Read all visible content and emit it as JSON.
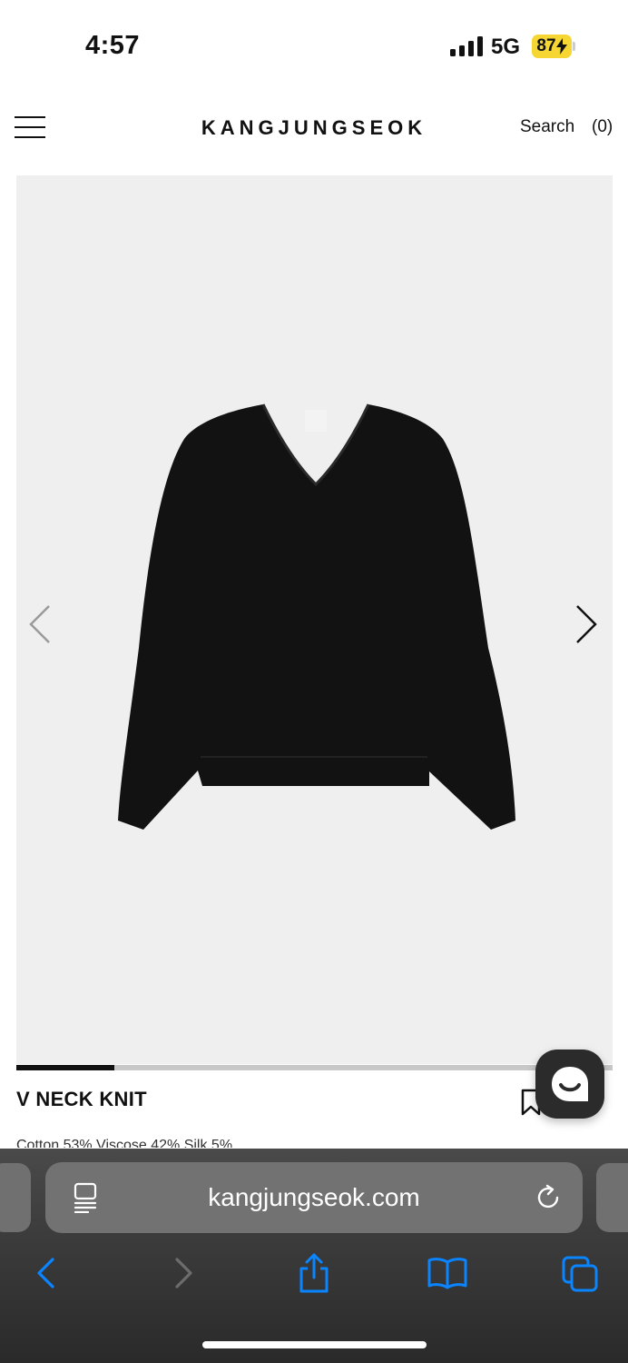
{
  "status": {
    "time": "4:57",
    "network": "5G",
    "battery": "87"
  },
  "header": {
    "brand": "KANGJUNGSEOK",
    "search_label": "Search",
    "cart_label": "(0)"
  },
  "product": {
    "name": "V NECK KNIT",
    "material": "Cotton 53% Viscose 42% Silk 5%",
    "carousel_progress": 0.165
  },
  "browser": {
    "url": "kangjungseok.com"
  },
  "colors": {
    "accent": "#0a84ff",
    "image_bg": "#efefef",
    "battery": "#f6d633"
  }
}
